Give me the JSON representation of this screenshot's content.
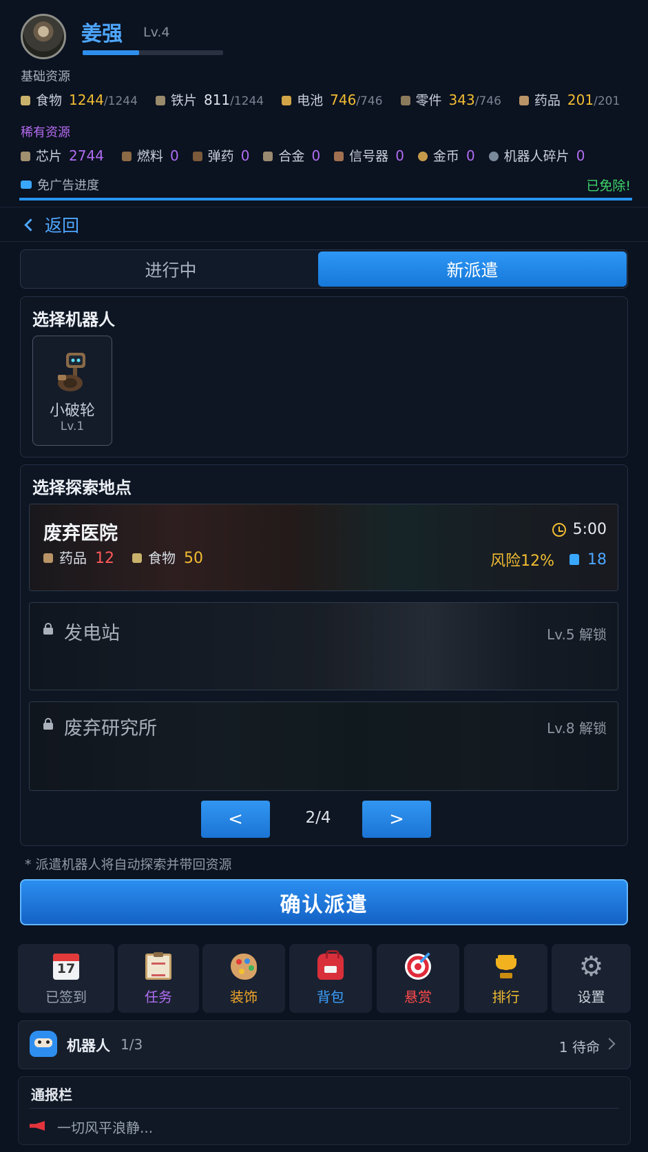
{
  "colors": {
    "accent": "#2f8fef",
    "gold": "#f2bd32",
    "rare": "#b06df2",
    "success": "#3fd46c",
    "background": "#0b1220"
  },
  "player": {
    "name": "姜强",
    "level": "Lv.4",
    "xp_fraction": 0.4
  },
  "basic_resources": {
    "label": "基础资源",
    "items": [
      {
        "name": "食物",
        "value": "1244",
        "max": "/1244",
        "icon": "food-icon",
        "color": "#c9b26b"
      },
      {
        "name": "铁片",
        "value": "811",
        "max": "/1244",
        "icon": "iron-icon",
        "color": "#9a8a6c"
      },
      {
        "name": "电池",
        "value": "746",
        "max": "/746",
        "icon": "battery-icon",
        "color": "#d0a447"
      },
      {
        "name": "零件",
        "value": "343",
        "max": "/746",
        "icon": "parts-icon",
        "color": "#8c7a5c"
      },
      {
        "name": "药品",
        "value": "201",
        "max": "/201",
        "icon": "medicine-icon",
        "color": "#b89467"
      }
    ]
  },
  "rare_resources": {
    "label": "稀有资源",
    "items": [
      {
        "name": "芯片",
        "value": "2744",
        "icon": "chip-icon",
        "color": "#a09070"
      },
      {
        "name": "燃料",
        "value": "0",
        "icon": "fuel-icon",
        "color": "#8c6a45"
      },
      {
        "name": "弹药",
        "value": "0",
        "icon": "ammo-icon",
        "color": "#7a5a3a"
      },
      {
        "name": "合金",
        "value": "0",
        "icon": "alloy-icon",
        "color": "#9a8a70"
      },
      {
        "name": "信号器",
        "value": "0",
        "icon": "signal-icon",
        "color": "#a07050"
      },
      {
        "name": "金币",
        "value": "0",
        "icon": "coin-icon",
        "color": "#c49a4a"
      },
      {
        "name": "机器人碎片",
        "value": "0",
        "icon": "robot-fragment-icon",
        "color": "#7a8a9a"
      }
    ]
  },
  "ad_progress": {
    "label": "免广告进度",
    "status": "已免除!",
    "progress_fraction": 1.0
  },
  "nav": {
    "back_label": "返回"
  },
  "tabs": [
    {
      "label": "进行中",
      "active": false
    },
    {
      "label": "新派遣",
      "active": true
    }
  ],
  "robot_select": {
    "title": "选择机器人",
    "robots": [
      {
        "name": "小破轮",
        "level": "Lv.1"
      }
    ]
  },
  "location_select": {
    "title": "选择探索地点",
    "locations": [
      {
        "name": "废弃医院",
        "time": "5:00",
        "rewards": [
          {
            "name": "药品",
            "amount": "12",
            "amount_color": "#ff5a5a"
          },
          {
            "name": "食物",
            "amount": "50",
            "amount_color": "#f2bd32"
          }
        ],
        "risk": "风险12%",
        "robot_requirement": "18"
      },
      {
        "name": "发电站",
        "locked": true,
        "unlock": "Lv.5 解锁"
      },
      {
        "name": "废弃研究所",
        "locked": true,
        "unlock": "Lv.8 解锁"
      }
    ],
    "pagination": {
      "prev": "<",
      "next": ">",
      "page": "2/4"
    }
  },
  "hint": "* 派遣机器人将自动探索并带回资源",
  "confirm_label": "确认派遣",
  "bottom_nav": [
    {
      "label": "已签到",
      "color": "#98a1ae",
      "icon": "calendar-icon"
    },
    {
      "label": "任务",
      "color": "#b06df2",
      "icon": "clipboard-icon"
    },
    {
      "label": "装饰",
      "color": "#f2a72a",
      "icon": "palette-icon"
    },
    {
      "label": "背包",
      "color": "#3aa0ff",
      "icon": "backpack-icon"
    },
    {
      "label": "悬赏",
      "color": "#ff4a4a",
      "icon": "target-icon"
    },
    {
      "label": "排行",
      "color": "#f2bd32",
      "icon": "trophy-icon"
    },
    {
      "label": "设置",
      "color": "#c9d0da",
      "icon": "gear-icon"
    }
  ],
  "robot_bar": {
    "label": "机器人",
    "count": "1/3",
    "waiting": "1 待命"
  },
  "news": {
    "title": "通报栏",
    "message": "一切风平浪静..."
  }
}
